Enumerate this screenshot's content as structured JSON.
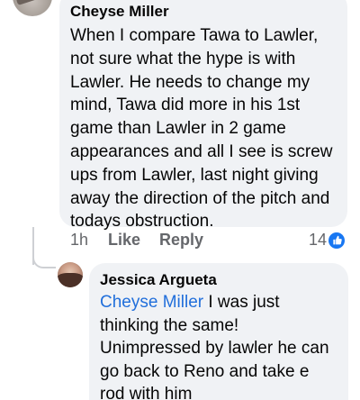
{
  "comment": {
    "author": "Cheyse Miller",
    "text": "When I compare Tawa to Lawler, not sure what the hype is with Lawler. He needs to change my mind, Tawa did more in his 1st game than Lawler in 2 game appearances and all I see is screw ups from Lawler, last night giving away the direction of the pitch and todays obstruction.",
    "time": "1h",
    "like_label": "Like",
    "reply_label": "Reply",
    "reaction_count": "14",
    "reaction_icon": "like-icon"
  },
  "reply": {
    "author": "Jessica Argueta",
    "mention": "Cheyse Miller",
    "text": "I was just thinking the same! Unimpressed by lawler he can go back to Reno and take e rod with him"
  },
  "colors": {
    "bubble": "#f0f2f5",
    "mention": "#216fdb",
    "like_blue": "#1877f2",
    "meta_gray": "#65676b"
  }
}
